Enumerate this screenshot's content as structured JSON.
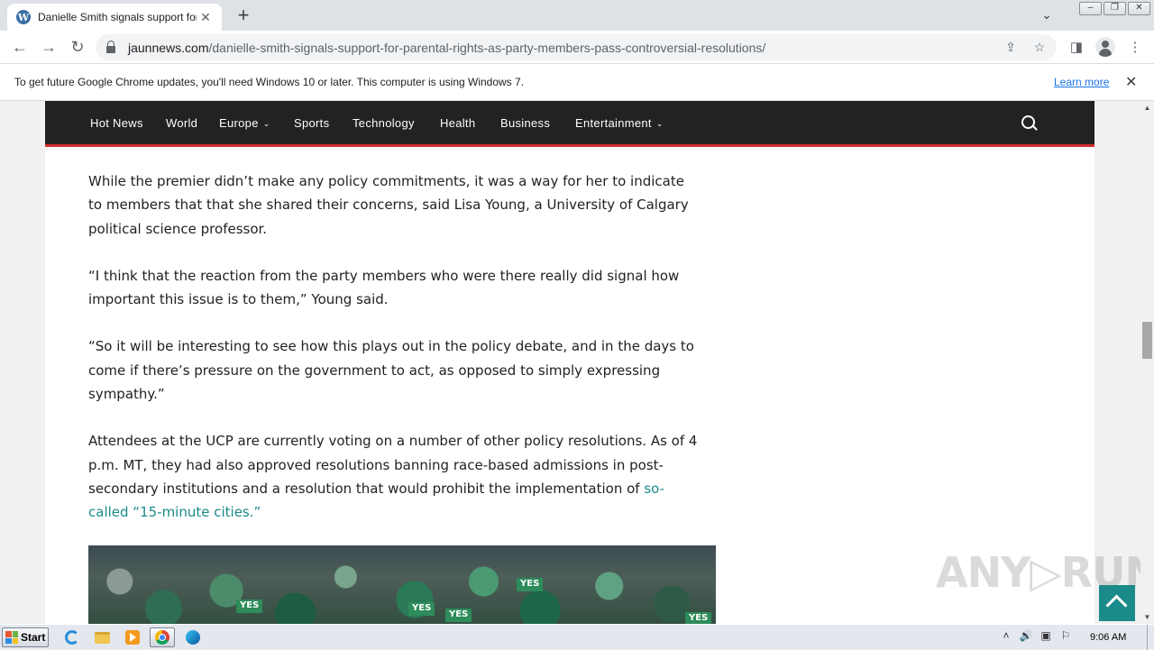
{
  "browser": {
    "tab": {
      "title": "Danielle Smith signals support for 'pa",
      "favicon_letter": "W"
    },
    "url": {
      "host": "jaunnews.com",
      "path": "/danielle-smith-signals-support-for-parental-rights-as-party-members-pass-controversial-resolutions/"
    },
    "icons": {
      "back": "←",
      "forward": "→",
      "reload": "↻",
      "share": "⇪",
      "bookmark": "☆",
      "sidepanel": "◨",
      "menu": "⋮",
      "new_tab": "+",
      "tab_close": "✕",
      "tab_dropdown": "⌄",
      "minimize": "‒",
      "restore": "❐",
      "close": "✕"
    }
  },
  "infobar": {
    "message": "To get future Google Chrome updates, you'll need Windows 10 or later. This computer is using Windows 7.",
    "learn_more": "Learn more",
    "close": "✕"
  },
  "site_nav": {
    "items": [
      {
        "label": "Hot News"
      },
      {
        "label": "World"
      },
      {
        "label": "Europe",
        "dropdown": true
      },
      {
        "label": "Sports"
      },
      {
        "label": "Technology"
      },
      {
        "label": "Health"
      },
      {
        "label": "Business"
      },
      {
        "label": "Entertainment",
        "dropdown": true
      }
    ],
    "caret": "⌄",
    "accent_color": "#d22e2e"
  },
  "article": {
    "paragraphs": [
      "While the premier didn’t make any policy commitments, it was a way for her to indicate to members that that she shared their concerns, said Lisa Young, a University of Calgary political science professor.",
      "“I think that the reaction from the party members who were there really did signal how important this issue is to them,” Young said.",
      "“So it will be interesting to see how this plays out in the policy debate, and in the days to come if there’s pressure on the government to act, as opposed to simply expressing sympathy.”"
    ],
    "last_paragraph_text": "Attendees at the UCP are currently voting on a number of other policy resolutions. As of 4 p.m. MT, they had also approved resolutions banning race-based admissions in post-secondary institutions and a resolution that would prohibit the implementation of ",
    "last_paragraph_link": "so-called “15-minute cities.”",
    "link_color": "#1b8a8a",
    "photo_signs": [
      "YES",
      "YES",
      "YES",
      "YES",
      "YES"
    ]
  },
  "watermark": "ANY▷RUN",
  "taskbar": {
    "start_label": "Start",
    "clock": "9:06 AM",
    "tray_icons": [
      "˄",
      "🔊",
      "▣",
      "⚐"
    ]
  }
}
